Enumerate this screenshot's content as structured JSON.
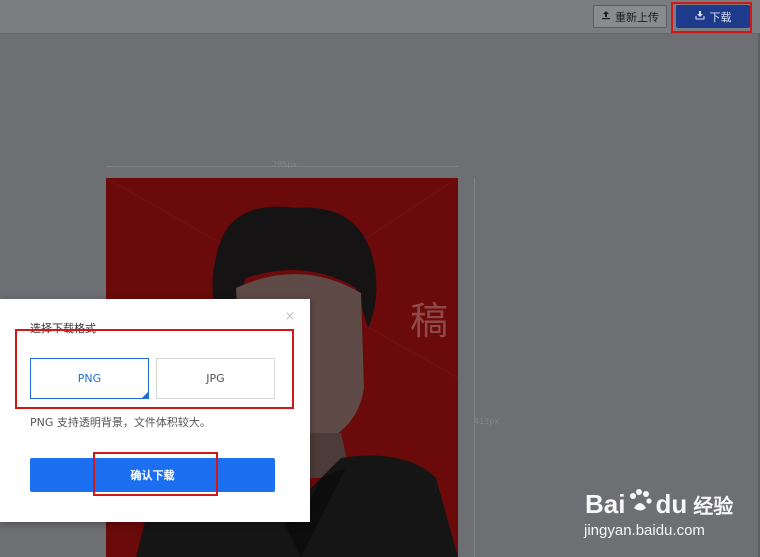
{
  "toolbar": {
    "reupload_label": "重新上传",
    "download_label": "下载"
  },
  "canvas": {
    "width_label": "295px",
    "height_label": "413px",
    "watermark": "稿"
  },
  "dialog": {
    "title": "选择下载格式",
    "formats": [
      {
        "label": "PNG",
        "selected": true
      },
      {
        "label": "JPG",
        "selected": false
      }
    ],
    "description": "PNG 支持透明背景，文件体积较大。",
    "confirm_label": "确认下载",
    "close_symbol": "×"
  },
  "watermark": {
    "logo_text_bai": "Bai",
    "logo_text_du": "du",
    "logo_text_cn": "经验",
    "url": "jingyan.baidu.com"
  },
  "colors": {
    "accent": "#1d6ff2",
    "highlight": "#d01818",
    "photo_bg": "#6b0a0a"
  }
}
